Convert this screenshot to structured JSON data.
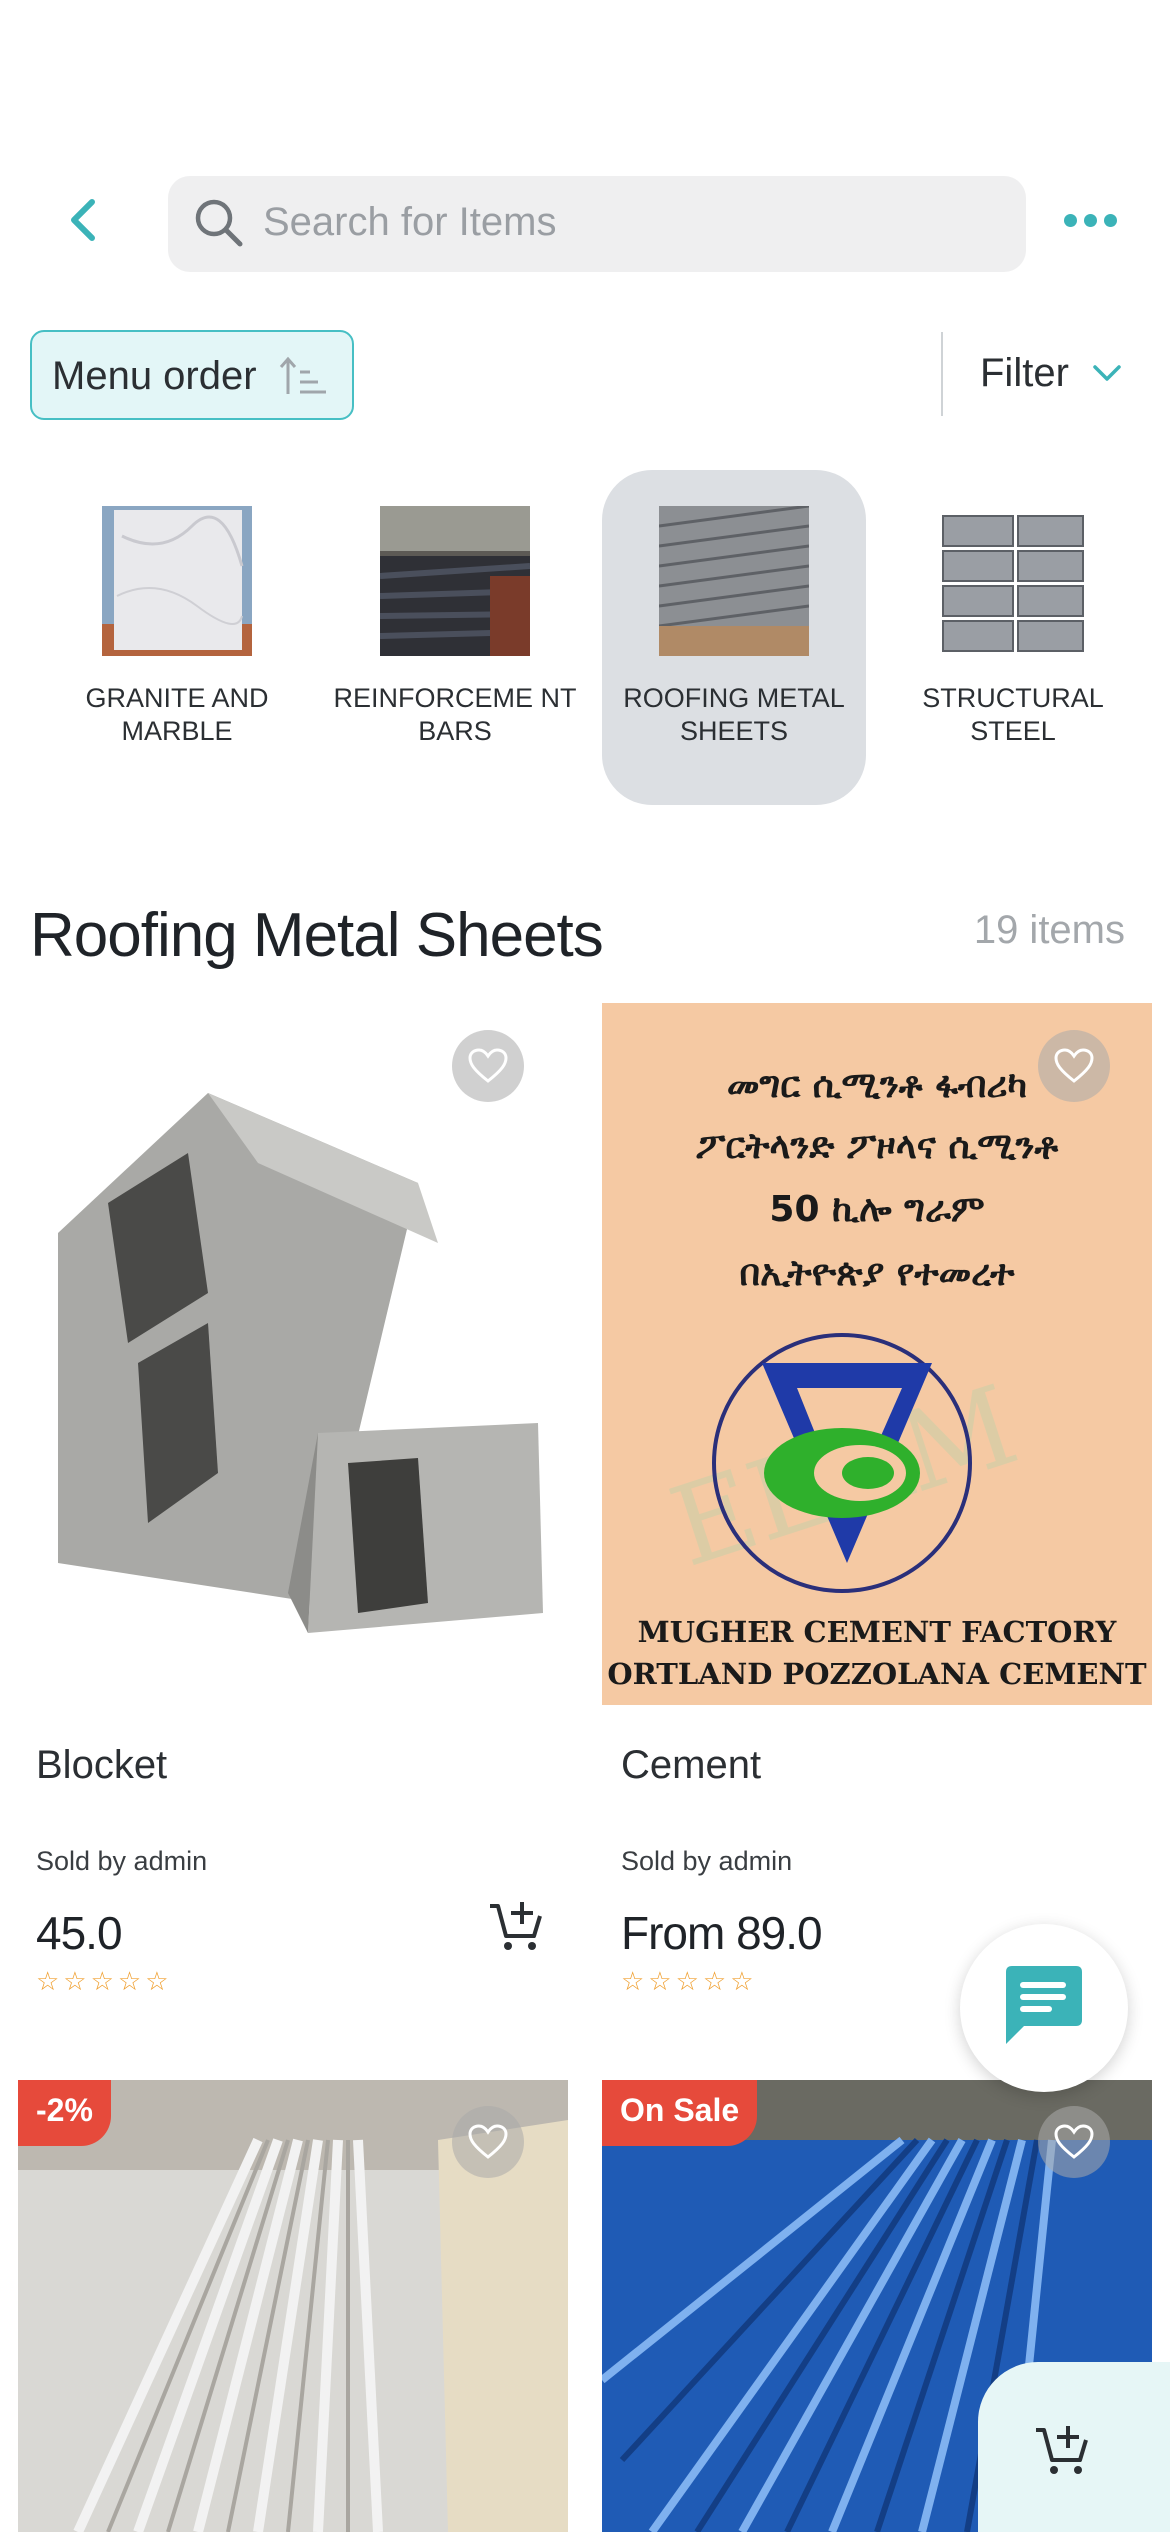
{
  "header": {
    "search_placeholder": "Search for Items"
  },
  "controls": {
    "sort_label": "Menu order",
    "filter_label": "Filter"
  },
  "categories": [
    {
      "name": "GRANITE AND MARBLE",
      "active": false
    },
    {
      "name": "REINFORCEME NT BARS",
      "active": false
    },
    {
      "name": "ROOFING METAL SHEETS",
      "active": true
    },
    {
      "name": "STRUCTURAL STEEL",
      "active": false
    }
  ],
  "section": {
    "title": "Roofing Metal Sheets",
    "count": "19 items"
  },
  "products": [
    {
      "name": "Blocket",
      "seller": "Sold by admin",
      "price": "45.0",
      "stars": "☆☆☆☆☆",
      "rating": 0
    },
    {
      "name": "Cement",
      "seller": "Sold by admin",
      "price": "From 89.0",
      "stars": "☆☆☆☆☆",
      "rating": 0,
      "image_text": {
        "line1": "መግር ሲሚንቶ ፋብሪካ",
        "line2": "ፖርትላንድ ፖዞላና ሲሚንቶ",
        "line3": "50 ኪሎ ግራም",
        "line4": "በኢትዮጵያ የተመረተ",
        "line5": "MUGHER CEMENT FACTORY",
        "line6": "ORTLAND POZZOLANA CEMENT"
      }
    },
    {
      "badge": "-2%"
    },
    {
      "badge": "On Sale"
    }
  ],
  "colors": {
    "accent": "#3bb3b8",
    "sale_badge": "#e64a3b",
    "star": "#f0a030"
  }
}
